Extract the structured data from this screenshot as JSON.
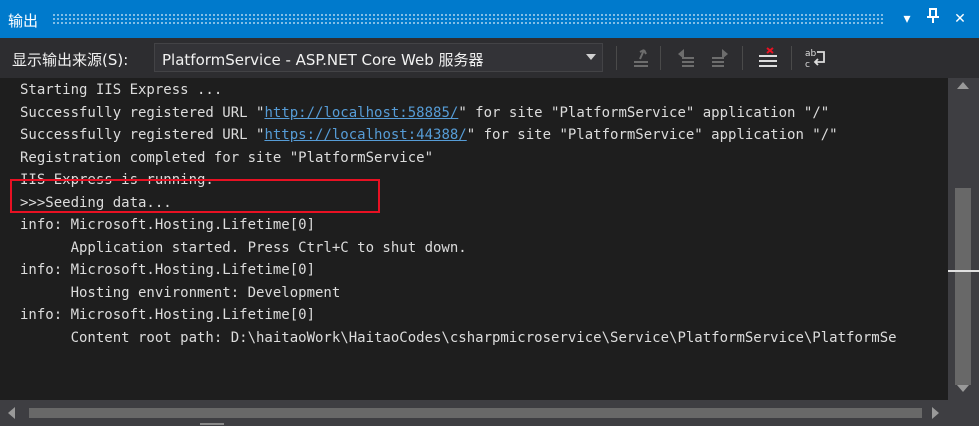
{
  "window": {
    "title": "输出",
    "buttons": {
      "dropdown": "▾",
      "pin": "⊥",
      "close": "✕"
    }
  },
  "toolbar": {
    "source_label": "显示输出来源(S):",
    "source_value": "PlatformService - ASP.NET Core Web 服务器",
    "tools": [
      "go-to-location-icon",
      "previous-message-icon",
      "next-message-icon",
      "clear-all-icon",
      "toggle-word-wrap-icon"
    ]
  },
  "output": {
    "lines": [
      {
        "text": "Starting IIS Express ..."
      },
      {
        "pre": "Successfully registered URL \"",
        "link": "http://localhost:58885/",
        "post": "\" for site \"PlatformService\" application \"/\""
      },
      {
        "pre": "Successfully registered URL \"",
        "link": "https://localhost:44388/",
        "post": "\" for site \"PlatformService\" application \"/\""
      },
      {
        "text": "Registration completed for site \"PlatformService\""
      },
      {
        "text": "IIS Express is running."
      },
      {
        "text": ">>>Seeding data..."
      },
      {
        "text": "info: Microsoft.Hosting.Lifetime[0]"
      },
      {
        "text": "      Application started. Press Ctrl+C to shut down."
      },
      {
        "text": "info: Microsoft.Hosting.Lifetime[0]"
      },
      {
        "text": "      Hosting environment: Development"
      },
      {
        "text": "info: Microsoft.Hosting.Lifetime[0]"
      },
      {
        "text": "      Content root path: D:\\haitaoWork\\HaitaoCodes\\csharpmicroservice\\Service\\PlatformService\\PlatformSe"
      }
    ],
    "highlighted_line_index": 5
  },
  "colors": {
    "titlebar": "#007acc",
    "background": "#1e1e1e",
    "text": "#dcdcdc",
    "link": "#569cd6",
    "highlight_border": "#e81123"
  }
}
